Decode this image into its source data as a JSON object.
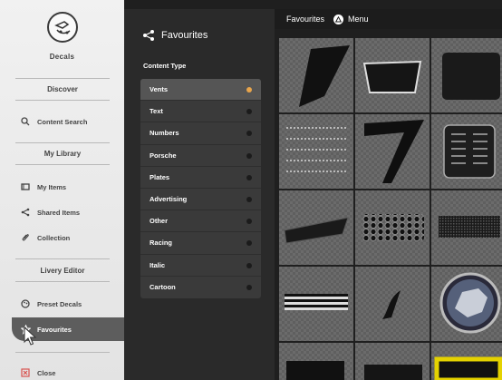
{
  "sidebar": {
    "app_title": "Decals",
    "sections": {
      "discover": "Discover",
      "my_library": "My Library",
      "livery_editor": "Livery Editor"
    },
    "items": {
      "content_search": "Content Search",
      "my_items": "My Items",
      "shared_items": "Shared Items",
      "collection": "Collection",
      "preset_decals": "Preset Decals",
      "favourites": "Favourites",
      "close": "Close"
    }
  },
  "panel": {
    "title": "Favourites",
    "content_type_label": "Content Type",
    "content_types": [
      "Vents",
      "Text",
      "Numbers",
      "Porsche",
      "Plates",
      "Advertising",
      "Other",
      "Racing",
      "Italic",
      "Cartoon"
    ],
    "selected_index": 0
  },
  "topbar": {
    "title": "Favourites",
    "menu_label": "Menu"
  },
  "grid": {
    "tiles": [
      "vent-slanted-scoop",
      "vent-hood-scoop",
      "vent-rectangle-dark",
      "vent-side-lines",
      "vent-seven-shape",
      "vent-twin-grille",
      "vent-angled-grille",
      "vent-honeycomb-mesh",
      "vent-fine-mesh",
      "vent-horizontal-slats",
      "vent-small-curve",
      "vent-lion-badge",
      "vent-bottom-left",
      "vent-bottom-mid",
      "vent-yellow-frame"
    ]
  },
  "colors": {
    "selected_dot": "#e8a54c",
    "active_sidebar": "#5d5d5d",
    "yellow_tile_accent": "#e4d200"
  }
}
